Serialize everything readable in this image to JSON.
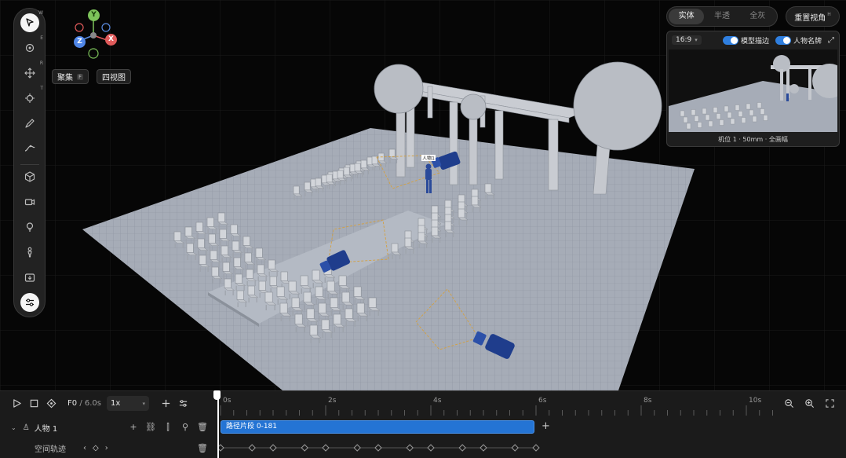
{
  "viewport": {
    "billboard_label": "人物1",
    "navigation": {
      "focus_label": "聚集",
      "focus_key": "F",
      "quad_view_label": "四视图"
    },
    "gizmo": {
      "y": "Y",
      "z": "Z",
      "x": "X"
    },
    "toolbar": {
      "items": [
        {
          "icon": "select-arrow-icon",
          "hotkey": "W"
        },
        {
          "icon": "rotate-icon",
          "hotkey": "E"
        },
        {
          "icon": "move-icon",
          "hotkey": "R"
        },
        {
          "icon": "scale-icon",
          "hotkey": "T"
        },
        {
          "icon": "pen-icon",
          "hotkey": ""
        },
        {
          "icon": "path-icon",
          "hotkey": ""
        },
        {
          "icon": "cube-icon",
          "hotkey": ""
        },
        {
          "icon": "camera-icon",
          "hotkey": ""
        },
        {
          "icon": "light-icon",
          "hotkey": ""
        },
        {
          "icon": "person-icon",
          "hotkey": ""
        },
        {
          "icon": "import-icon",
          "hotkey": ""
        },
        {
          "icon": "settings-sliders-icon",
          "hotkey": ""
        }
      ]
    }
  },
  "render_mode": {
    "options": [
      "实体",
      "半透",
      "全灰"
    ],
    "selected": "实体"
  },
  "reset_view": {
    "label": "重置视角",
    "hotkey": "H"
  },
  "preview": {
    "ratio": "16:9",
    "model_outline_label": "模型描边",
    "model_outline_on": true,
    "name_tag_label": "人物名牌",
    "name_tag_on": true,
    "caption": "机位 1 · 50mm · 全画幅"
  },
  "timeline": {
    "current_time": "F0",
    "total_time": "/ 6.0s",
    "speed": "1x",
    "ruler_labels": [
      "0s",
      "2s",
      "4s",
      "6s",
      "8s",
      "10s"
    ],
    "tracks": [
      {
        "label": "人物 1",
        "clip_label": "路径片段 0-181"
      },
      {
        "label": "空间轨迹"
      }
    ],
    "keyframes": [
      0,
      0.6,
      1.0,
      1.6,
      2.0,
      2.6,
      3.0,
      3.6,
      4.0,
      4.6,
      5.0,
      5.6,
      6.0
    ],
    "accent_color": "#2474d4"
  }
}
